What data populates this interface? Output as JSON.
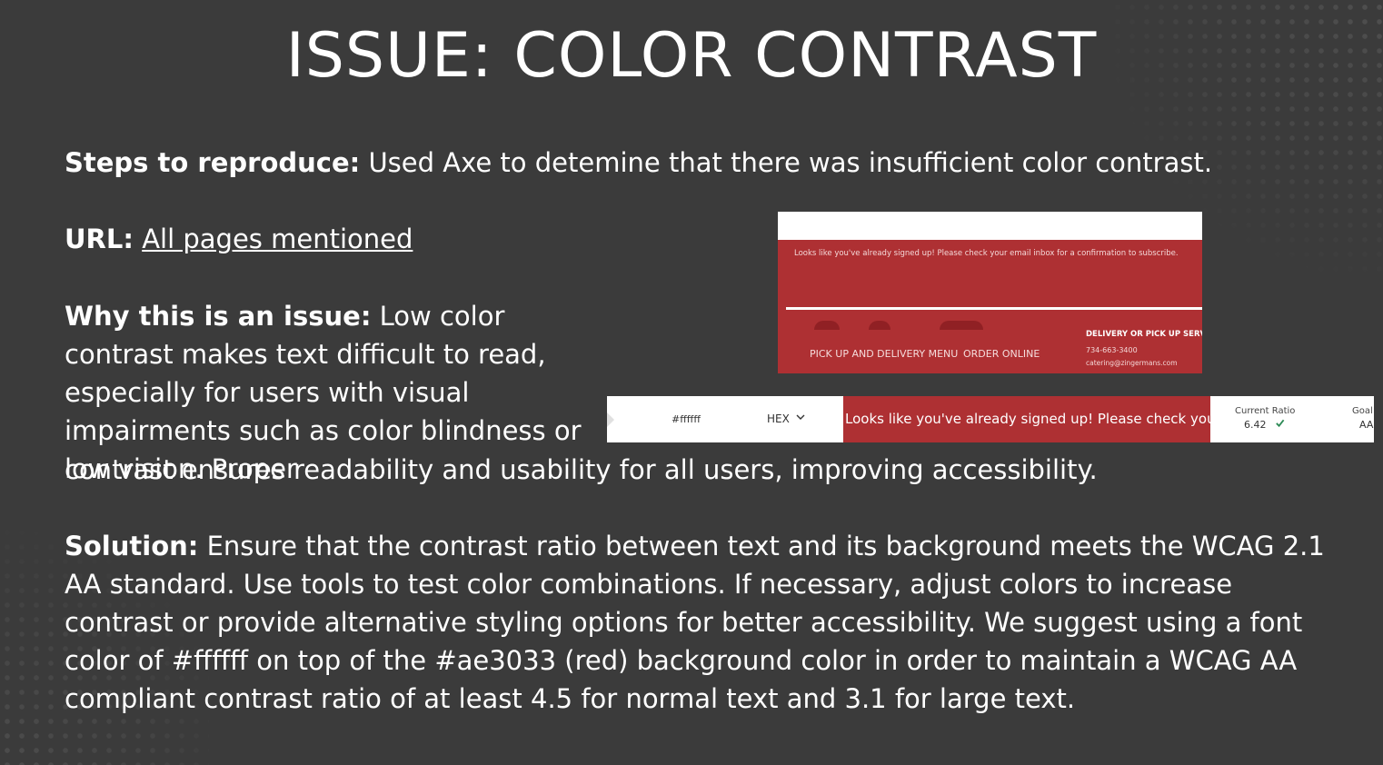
{
  "title": "ISSUE: COLOR CONTRAST",
  "steps": {
    "label": "Steps to reproduce:",
    "text": " Used Axe to detemine that there was insufficient color contrast."
  },
  "url": {
    "label": "URL:",
    "link_text": "All pages mentioned"
  },
  "why": {
    "label": "Why this is an issue:",
    "text_part1": " Low color contrast makes text difficult to read, especially for users with visual impairments such as color blindness or low vision. Proper",
    "text_part2": "contrast ensures readability and usability for all users, improving accessibility."
  },
  "solution": {
    "label": "Solution:",
    "text": " Ensure that the contrast ratio between text and its background meets the WCAG 2.1 AA standard. Use tools to test color combinations. If necessary, adjust colors to increase contrast or provide alternative styling options for better accessibility. We suggest using a font color of #ffffff on top of the #ae3033 (red) background color in order to maintain a WCAG AA compliant contrast ratio of at least 4.5 for normal text and 3.1 for large text."
  },
  "screenshot1": {
    "message": "Looks like you've already signed up! Please check your email inbox for a confirmation to subscribe.",
    "nav_menu": "PICK UP AND DELIVERY MENU",
    "nav_order": "ORDER ONLINE",
    "delivery_heading": "DELIVERY OR PICK UP SERVI",
    "phone": "734-663-3400",
    "email": "catering@zingermans.com"
  },
  "screenshot2": {
    "hex_value": "#ffffff",
    "format_label": "HEX",
    "preview_text": "Looks like you've already signed up! Please check your e",
    "ratio_label": "Current Ratio",
    "ratio_value": "6.42",
    "goal_label": "Goal",
    "goal_value": "AA"
  },
  "colors": {
    "background": "#3b3b3b",
    "text": "#ffffff",
    "brand_red": "#ae3033",
    "check_green": "#2e8b57"
  },
  "icons": [
    "chevron-down-icon",
    "checkmark-icon"
  ]
}
